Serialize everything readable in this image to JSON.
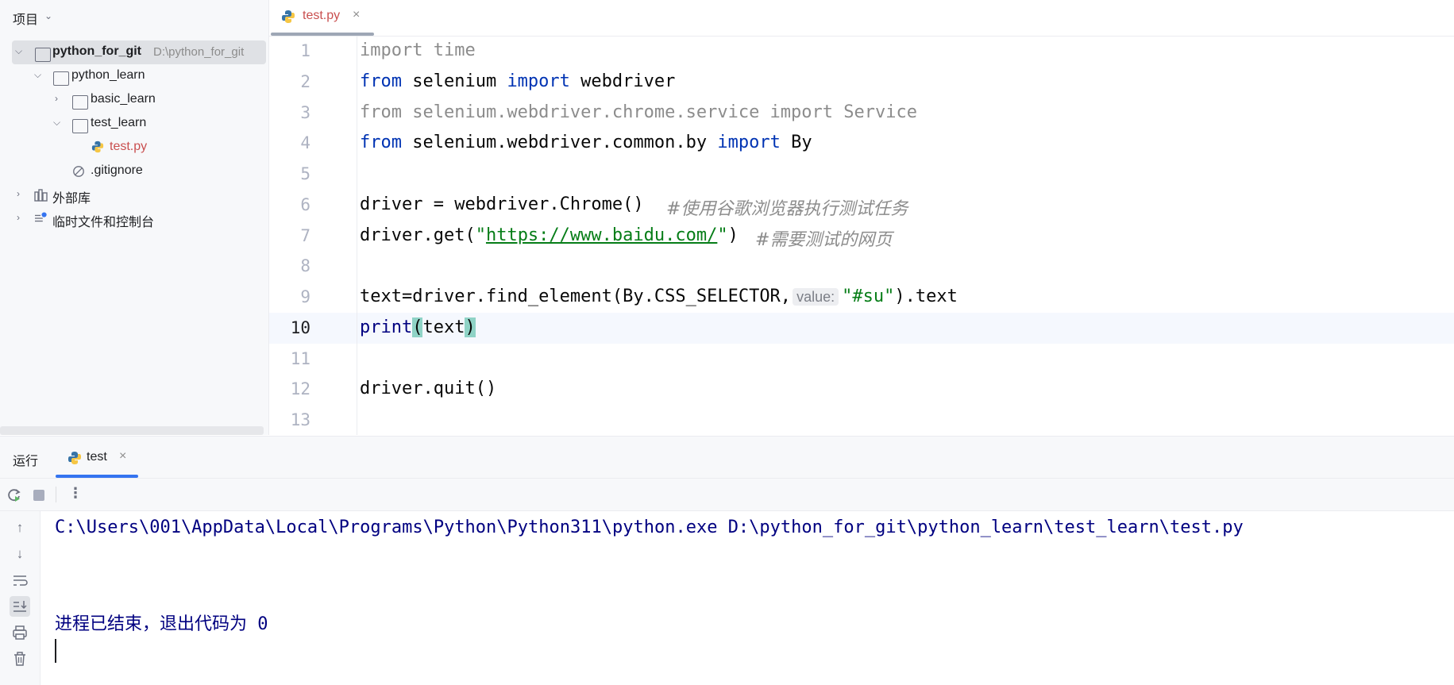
{
  "project": {
    "title": "项目",
    "chevron": "chevron-down-icon",
    "tree": [
      {
        "label": "python_for_git",
        "path": "D:\\python_for_git",
        "icon": "folder-icon",
        "expanded": true
      },
      {
        "label": "python_learn",
        "icon": "folder-icon",
        "expanded": true
      },
      {
        "label": "basic_learn",
        "icon": "folder-icon",
        "expanded": false
      },
      {
        "label": "test_learn",
        "icon": "folder-icon",
        "expanded": true
      },
      {
        "label": "test.py",
        "icon": "python-file-icon"
      },
      {
        "label": ".gitignore",
        "icon": "ignored-file-icon"
      },
      {
        "label": "外部库",
        "icon": "library-icon",
        "expanded": false
      },
      {
        "label": "临时文件和控制台",
        "icon": "scratches-icon",
        "expanded": false
      }
    ]
  },
  "editor": {
    "tab": {
      "label": "test.py",
      "close": "×"
    },
    "line_numbers": [
      "1",
      "2",
      "3",
      "4",
      "5",
      "6",
      "7",
      "8",
      "9",
      "10",
      "11",
      "12",
      "13"
    ],
    "current_line": "10",
    "code": {
      "l1_a": "import",
      "l1_b": " time",
      "l2_a": "from",
      "l2_b": " selenium ",
      "l2_c": "import",
      "l2_d": " webdriver",
      "l3": "from selenium.webdriver.chrome.service import Service",
      "l4_a": "from",
      "l4_b": " selenium.webdriver.common.by ",
      "l4_c": "import",
      "l4_d": " By",
      "l6_a": "driver = webdriver.Chrome()",
      "l6_b": "#使用谷歌浏览器执行测试任务",
      "l7_a": "driver.get(",
      "l7_q1": "\"",
      "l7_url": "https://www.baidu.com/",
      "l7_q2": "\"",
      "l7_b": ")",
      "l7_c": "#需要测试的网页",
      "l9_a": "text=driver.find_element(By.CSS_SELECTOR,",
      "l9_hint": "value:",
      "l9_str": "\"#su\"",
      "l9_b": ").text",
      "l10_a": "print",
      "l10_p1": "(",
      "l10_b": "text",
      "l10_p2": ")",
      "l12": "driver.quit()"
    }
  },
  "run": {
    "title": "运行",
    "tab": {
      "label": "test",
      "close": "×"
    },
    "console": [
      "C:\\Users\\001\\AppData\\Local\\Programs\\Python\\Python311\\python.exe D:\\python_for_git\\python_learn\\test_learn\\test.py",
      "进程已结束，退出代码为 0"
    ]
  }
}
